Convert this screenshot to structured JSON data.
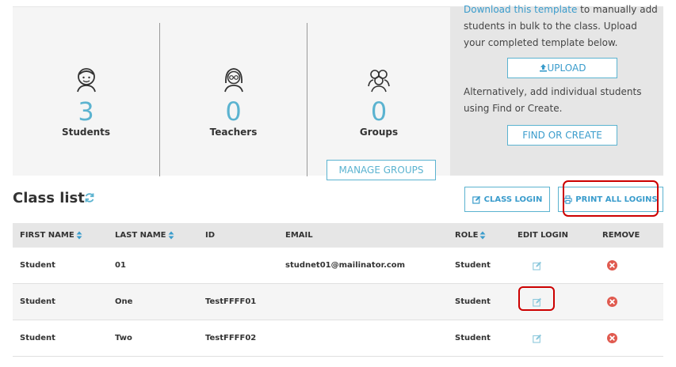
{
  "stats": {
    "students": {
      "count": "3",
      "label": "Students"
    },
    "teachers": {
      "count": "0",
      "label": "Teachers"
    },
    "groups": {
      "count": "0",
      "label": "Groups",
      "manage_label": "MANAGE GROUPS"
    }
  },
  "upload_panel": {
    "link_text": "Download this template",
    "intro_text": " to manually add students in bulk to the class. Upload your completed template below.",
    "upload_label": "UPLOAD",
    "alt_text": "Alternatively, add individual students using Find or Create.",
    "find_label": "FIND OR CREATE"
  },
  "class_list": {
    "title": "Class list",
    "class_login_label": "CLASS LOGIN",
    "print_logins_label": "PRINT ALL LOGINS"
  },
  "table": {
    "headers": {
      "first_name": "FIRST NAME",
      "last_name": "LAST NAME",
      "id": "ID",
      "email": "EMAIL",
      "role": "ROLE",
      "edit_login": "EDIT LOGIN",
      "remove": "REMOVE"
    },
    "rows": [
      {
        "first_name": "Student",
        "last_name": "01",
        "id": "",
        "email": "studnet01@mailinator.com",
        "role": "Student"
      },
      {
        "first_name": "Student",
        "last_name": "One",
        "id": "TestFFFF01",
        "email": "",
        "role": "Student"
      },
      {
        "first_name": "Student",
        "last_name": "Two",
        "id": "TestFFFF02",
        "email": "",
        "role": "Student"
      }
    ]
  },
  "colors": {
    "accent": "#5bb3d0",
    "link": "#3a9ccc",
    "remove": "#e05a4f",
    "highlight": "#cc0000"
  },
  "icons": {
    "students": "student-icon",
    "teachers": "teacher-icon",
    "groups": "groups-icon",
    "upload": "upload-icon",
    "refresh": "refresh-icon",
    "class_login": "edit-icon",
    "print": "printer-icon",
    "sort": "sort-icon",
    "edit": "edit-icon",
    "remove": "remove-icon"
  }
}
